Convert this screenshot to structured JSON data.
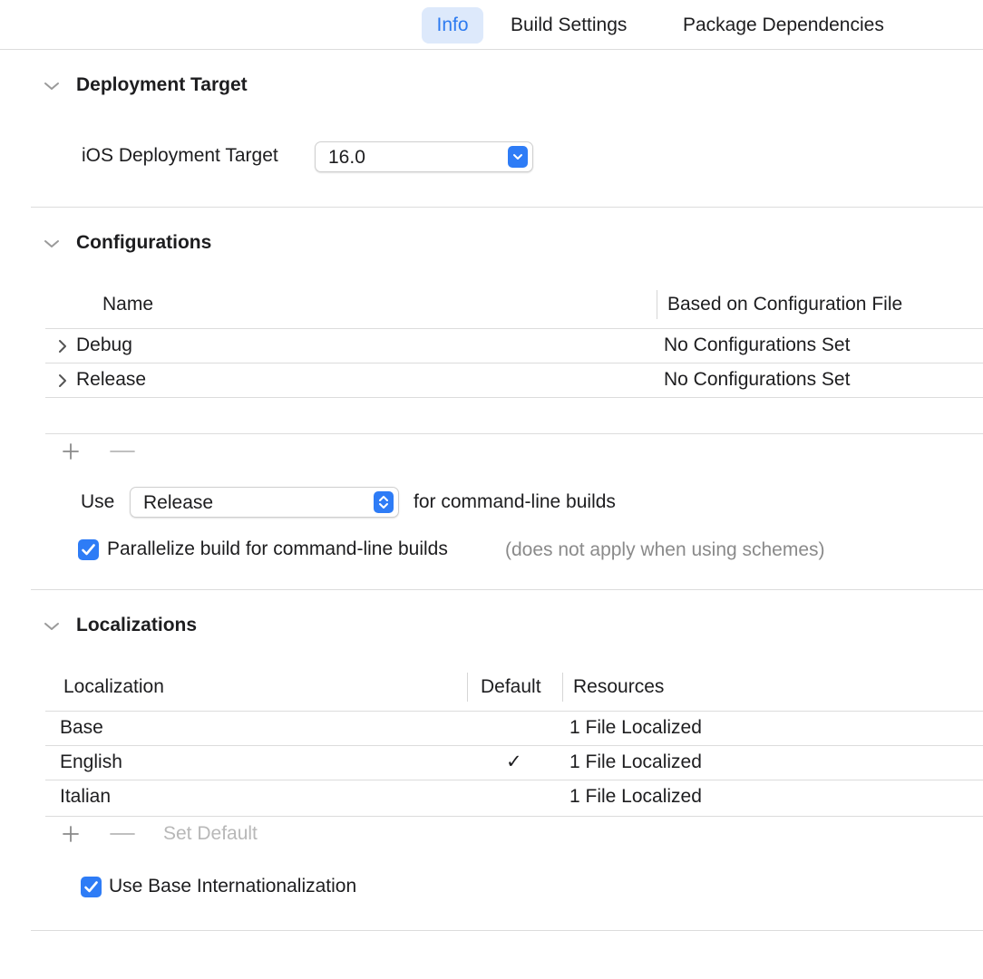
{
  "tabs": {
    "info": "Info",
    "build_settings": "Build Settings",
    "package_dependencies": "Package Dependencies"
  },
  "deployment": {
    "title": "Deployment Target",
    "ios_label": "iOS Deployment Target",
    "ios_value": "16.0"
  },
  "configurations": {
    "title": "Configurations",
    "col_name": "Name",
    "col_based_on": "Based on Configuration File",
    "rows": [
      {
        "name": "Debug",
        "based_on": "No Configurations Set"
      },
      {
        "name": "Release",
        "based_on": "No Configurations Set"
      }
    ],
    "use_label": "Use",
    "use_value": "Release",
    "use_suffix": "for command-line builds",
    "parallelize_label": "Parallelize build for command-line builds",
    "parallelize_note": "(does not apply when using schemes)",
    "parallelize_checked": true
  },
  "localizations": {
    "title": "Localizations",
    "col_localization": "Localization",
    "col_default": "Default",
    "col_resources": "Resources",
    "rows": [
      {
        "name": "Base",
        "default": "",
        "resources": "1 File Localized"
      },
      {
        "name": "English",
        "default": "✓",
        "resources": "1 File Localized"
      },
      {
        "name": "Italian",
        "default": "",
        "resources": "1 File Localized"
      }
    ],
    "set_default_label": "Set Default",
    "use_base_label": "Use Base Internationalization",
    "use_base_checked": true
  },
  "colors": {
    "accent": "#2e7cf6",
    "tab_selected_bg": "#dde9fb"
  }
}
